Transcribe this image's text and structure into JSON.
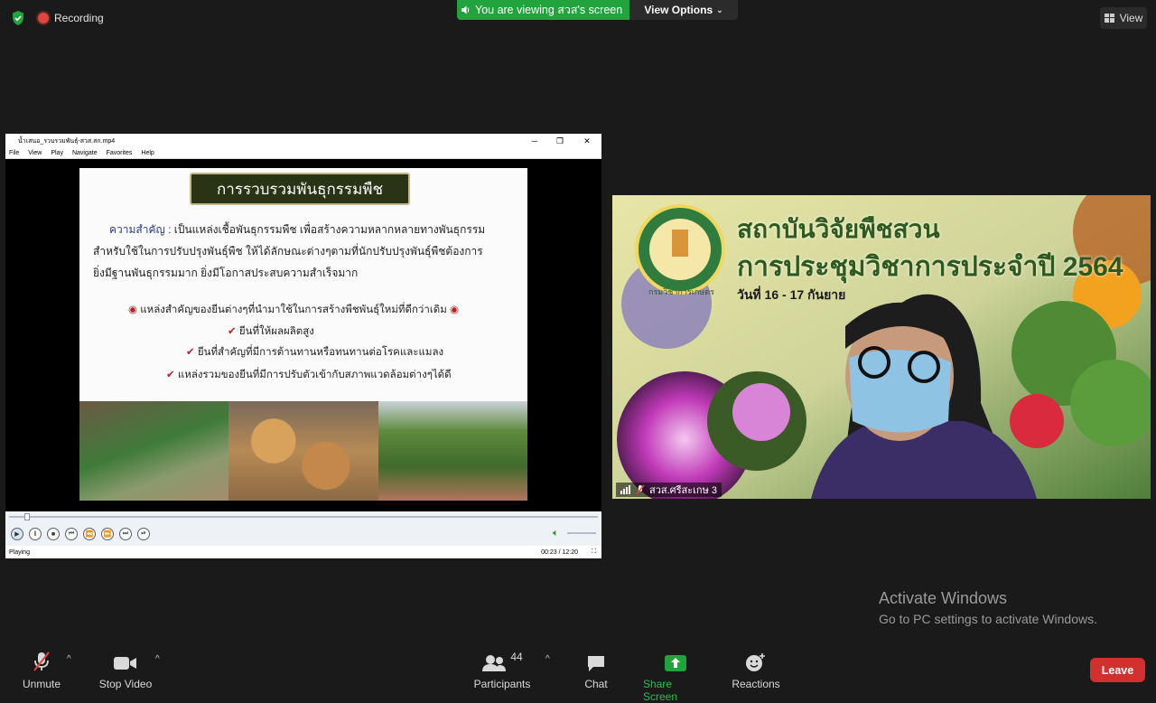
{
  "topbar": {
    "recording_label": "Recording",
    "viewing_banner": "You are viewing สวส's screen",
    "view_options_label": "View Options",
    "view_label": "View"
  },
  "player": {
    "title": "น้ำเสนอ_รวบรวมพันธุ์-สวส.สก.mp4",
    "menu": [
      "File",
      "View",
      "Play",
      "Navigate",
      "Favorites",
      "Help"
    ],
    "status": "Playing",
    "time": "00:23 / 12:20",
    "progress_fraction": 0.031
  },
  "slide": {
    "heading": "การรวบรวมพันธุกรรมพืช",
    "importance_label": "ความสำคัญ :",
    "line1": "เป็นแหล่งเชื้อพันธุกรรมพืช เพื่อสร้างความหลากหลายทางพันธุกรรม",
    "line2": "สำหรับใช้ในการปรับปรุงพันธุ์พืช ให้ได้ลักษณะต่างๆตามที่นักปรับปรุงพันธุ์พืชต้องการ",
    "line3": "ยิ่งมีฐานพันธุกรรมมาก ยิ่งมีโอกาสประสบความสำเร็จมาก",
    "bullets": [
      "แหล่งสำคัญของยีนต่างๆที่นำมาใช้ในการสร้างพืชพันธุ์ใหม่ที่ดีกว่าเดิม",
      "ยีนที่ให้ผลผลิตสูง",
      "ยีนที่สำคัญที่มีการต้านทานหรือทนทานต่อโรคและแมลง",
      "แหล่งรวมของยีนที่มีการปรับตัวเข้ากับสภาพแวดล้อมต่างๆได้ดี"
    ]
  },
  "participant": {
    "banner_title": "สถาบันวิจัยพืชสวน",
    "banner_subtitle": "การประชุมวิชาการประจำปี 2564",
    "banner_date": "วันที่ 16 - 17 กันยาย",
    "logo_text": "กรมวิชาการเกษตร",
    "name": "สวส.ศรีสะเกษ 3"
  },
  "watermark": {
    "title": "Activate Windows",
    "subtitle": "Go to PC settings to activate Windows."
  },
  "toolbar": {
    "unmute": "Unmute",
    "stop_video": "Stop Video",
    "participants": "Participants",
    "participants_count": "44",
    "chat": "Chat",
    "share_screen": "Share Screen",
    "reactions": "Reactions",
    "leave": "Leave"
  },
  "colors": {
    "share_green": "#23a33e",
    "leave_red": "#d2302f",
    "background": "#1a1a1a"
  }
}
